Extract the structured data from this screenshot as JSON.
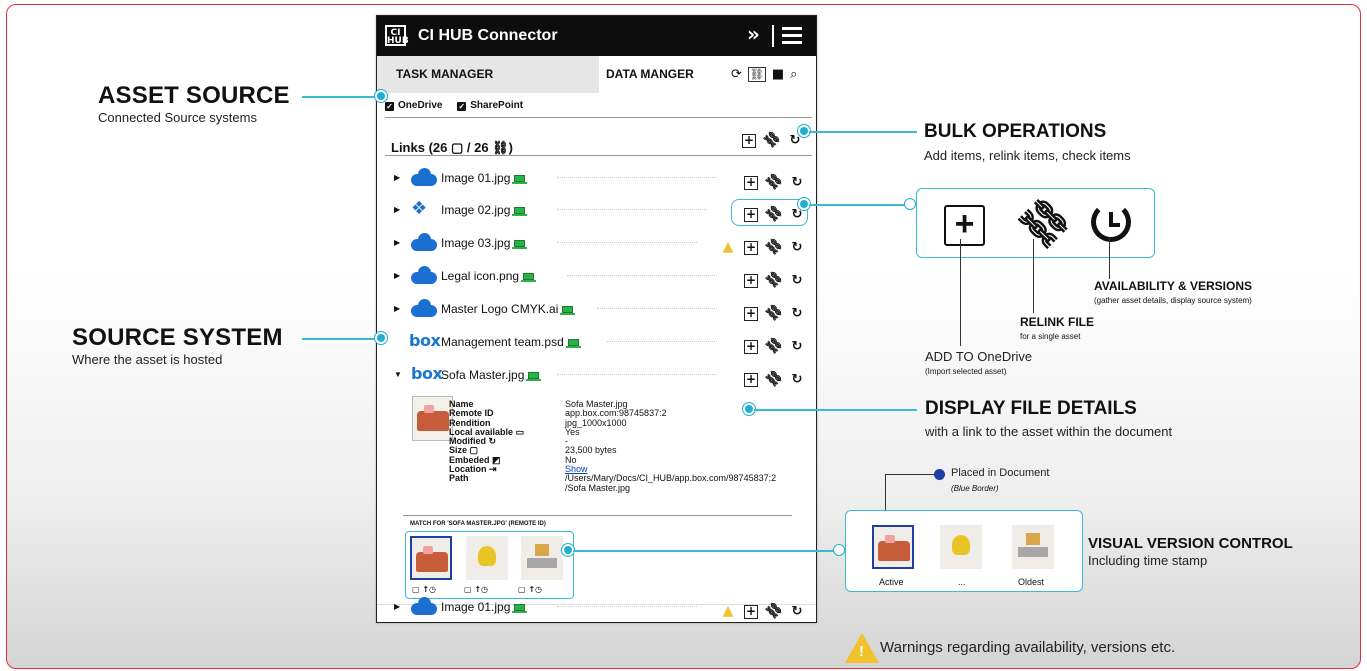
{
  "app": {
    "logo": "CI HUB",
    "title": "CI HUB Connector",
    "collapse_icon": "»",
    "menu_icon": "menu-icon"
  },
  "tabs": [
    {
      "label": "TASK MANAGER"
    },
    {
      "label": "DATA MANGER"
    }
  ],
  "tab_icons": [
    "sync-icon",
    "link-icon",
    "folder-icon",
    "search-icon"
  ],
  "sources": [
    {
      "label": "OneDrive",
      "checked": true
    },
    {
      "label": "SharePoint",
      "checked": true
    }
  ],
  "links_header": "Links (26 ▢ / 26 ⛓)",
  "files": [
    {
      "name": "Image 01.jpg",
      "source": "onedrive",
      "warning": false
    },
    {
      "name": "Image 02.jpg",
      "source": "dropbox",
      "warning": false
    },
    {
      "name": "Image 03.jpg",
      "source": "onedrive",
      "warning": true
    },
    {
      "name": "Legal icon.png",
      "source": "onedrive",
      "warning": false
    },
    {
      "name": "Master Logo CMYK.ai",
      "source": "onedrive",
      "warning": false
    },
    {
      "name": "Management team.psd",
      "source": "box",
      "warning": false
    },
    {
      "name": "Sofa Master.jpg",
      "source": "box",
      "warning": false
    },
    {
      "name": "Image 01.jpg",
      "source": "onedrive",
      "warning": true
    }
  ],
  "box_logo": "box",
  "details": {
    "name_k": "Name",
    "name_v": "Sofa Master.jpg",
    "remote_k": "Remote ID",
    "remote_v": "app.box.com:98745837:2",
    "rendition_k": "Rendition",
    "rendition_v": "jpg_1000x1000",
    "local_k": "Local available",
    "local_v": "Yes",
    "modified_k": "Modified",
    "modified_v": "-",
    "size_k": "Size",
    "size_v": "23,500 bytes",
    "embeded_k": "Embeded",
    "embeded_v": "No",
    "location_k": "Location",
    "location_v": "Show",
    "path_k": "Path",
    "path_v": "/Users/Mary/Docs/CI_HUB/app.box.com/98745837:2",
    "path_v2": "/Sofa Master.jpg"
  },
  "match_label": "MATCH FOR 'SOFA MASTER.JPG' (REMOTE ID)",
  "version_meta": "▢ ↑◷",
  "callouts": {
    "asset_source_title": "ASSET SOURCE",
    "asset_source_sub": "Connected Source systems",
    "source_system_title": "SOURCE SYSTEM",
    "source_system_sub": "Where the asset is hosted",
    "bulk_title": "BULK OPERATIONS",
    "bulk_sub": "Add items, relink items, check items",
    "avail_title": "AVAILABILITY & VERSIONS",
    "avail_sub": "(gather asset details, display source system)",
    "relink_title": "RELINK FILE",
    "relink_sub": "for a single asset",
    "add_title": "ADD TO OneDrive",
    "add_sub": "(Import selected asset)",
    "display_title": "DISPLAY FILE DETAILS",
    "display_sub": "with a link to the asset within the document",
    "placed_title": "Placed in Document",
    "placed_sub": "(Blue Border)",
    "vv_title": "VISUAL VERSION CONTROL",
    "vv_sub": "Including time stamp",
    "vv_labels": [
      "Active",
      "...",
      "Oldest"
    ],
    "warnings": "Warnings regarding availability, versions etc."
  },
  "colors": {
    "accent": "#1fb0d0",
    "frame": "#e0303a",
    "onedrive": "#1a6fd1",
    "active_border": "#1d3fa6",
    "warning": "#f2c12e"
  }
}
